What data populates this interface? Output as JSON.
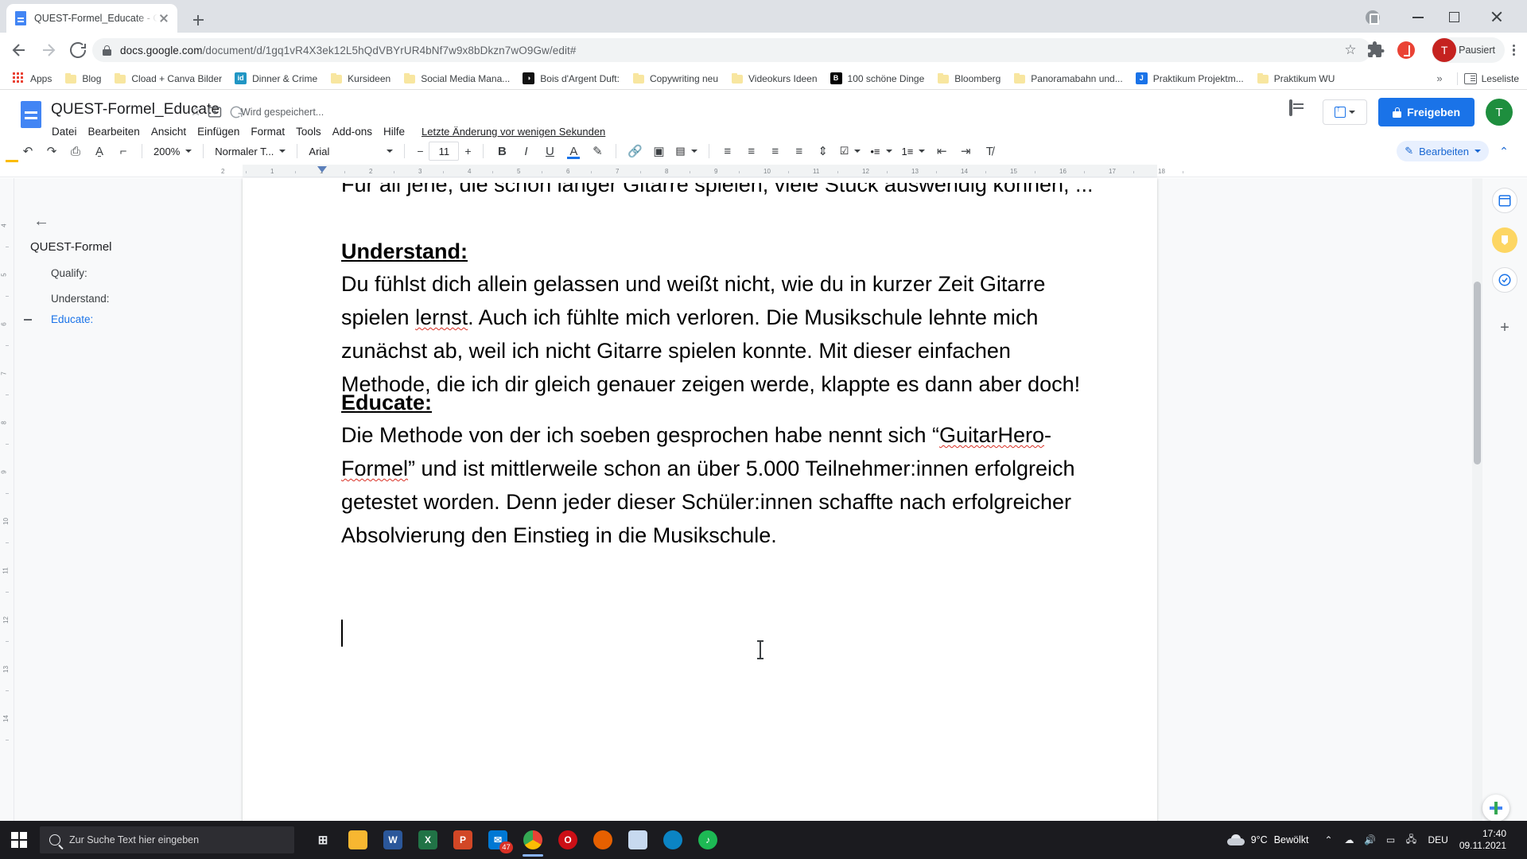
{
  "browser": {
    "tab": {
      "title": "QUEST-Formel_Educate - Google Docs",
      "favicon": "google-docs-icon"
    },
    "new_tab_label": "+",
    "url_host": "docs.google.com",
    "url_path": "/document/d/1gq1vR4X3ek12L5hQdVBYrUR4bNf7w9x8bDkzn7wO9Gw/edit#",
    "profile_label": "Pausiert",
    "profile_initial": "T",
    "bookmarks": [
      {
        "label": "Apps",
        "icon": "apps-grid-icon"
      },
      {
        "label": "Blog",
        "icon": "folder-icon"
      },
      {
        "label": "Cload + Canva Bilder",
        "icon": "folder-icon"
      },
      {
        "label": "Dinner & Crime",
        "icon": "id-favicon",
        "color": "#2196c4",
        "badge": "id"
      },
      {
        "label": "Kursideen",
        "icon": "folder-icon"
      },
      {
        "label": "Social Media Mana...",
        "icon": "folder-icon"
      },
      {
        "label": "Bois d'Argent Duft:",
        "icon": "site-favicon",
        "color": "#111111",
        "badge": "◑"
      },
      {
        "label": "Copywriting neu",
        "icon": "folder-icon"
      },
      {
        "label": "Videokurs Ideen",
        "icon": "folder-icon"
      },
      {
        "label": "100 schöne Dinge",
        "icon": "site-favicon",
        "color": "#000000",
        "badge": "B"
      },
      {
        "label": "Bloomberg",
        "icon": "folder-icon"
      },
      {
        "label": "Panoramabahn und...",
        "icon": "folder-icon"
      },
      {
        "label": "Praktikum Projektm...",
        "icon": "site-favicon",
        "color": "#1a73e8",
        "badge": "J"
      },
      {
        "label": "Praktikum WU",
        "icon": "folder-icon"
      }
    ],
    "overflow_label": "»",
    "reading_list_label": "Leseliste"
  },
  "docs": {
    "title": "QUEST-Formel_Educate",
    "save_state": "Wird gespeichert...",
    "menu": [
      "Datei",
      "Bearbeiten",
      "Ansicht",
      "Einfügen",
      "Format",
      "Tools",
      "Add-ons",
      "Hilfe"
    ],
    "last_edit": "Letzte Änderung vor wenigen Sekunden",
    "share_label": "Freigeben",
    "present_label": "",
    "avatar_initial": "T",
    "toolbar": {
      "zoom": "200%",
      "style": "Normaler T...",
      "font": "Arial",
      "font_size": "11",
      "minus": "−",
      "plus": "+",
      "mode_label": "Bearbeiten"
    },
    "outline": {
      "heading": "QUEST-Formel",
      "items": [
        "Qualify:",
        "Understand:",
        "Educate:"
      ],
      "active_index": 2
    },
    "ruler_ticks": [
      "2",
      "1",
      "1",
      "2",
      "3",
      "4",
      "5",
      "6",
      "7",
      "8",
      "9",
      "10",
      "11",
      "12",
      "13",
      "14",
      "15",
      "16",
      "17",
      "18"
    ],
    "vruler_ticks": [
      "4",
      "5",
      "6",
      "7",
      "8",
      "9",
      "10",
      "11",
      "12",
      "13",
      "14"
    ],
    "content": {
      "truncated_top": "Für all jene, die schon länger Gitarre spielen, viele Stück auswendig können, ...",
      "blocks": [
        {
          "type": "heading",
          "text": "Understand:"
        },
        {
          "type": "paragraph",
          "runs": [
            {
              "t": "Du fühlst dich allein gelassen und weißt nicht, wie du in kurzer Zeit Gitarre spielen "
            },
            {
              "t": "lernst",
              "spell": true
            },
            {
              "t": ". Auch ich fühlte mich verloren. Die Musikschule lehnte mich zunächst ab, weil ich nicht Gitarre spielen konnte. Mit dieser einfachen Methode, die ich dir gleich genauer zeigen werde, klappte es dann aber doch!"
            }
          ]
        },
        {
          "type": "heading",
          "text": "Educate:"
        },
        {
          "type": "paragraph",
          "runs": [
            {
              "t": "Die Methode von der ich soeben gesprochen habe nennt sich “"
            },
            {
              "t": "GuitarHero",
              "spell": true
            },
            {
              "t": "-"
            },
            {
              "t": "Formel",
              "spell": true
            },
            {
              "t": "” und ist mittlerweile schon an über 5.000 Teilnehmer:innen erfolgreich getestet worden. Denn jeder dieser Schüler:innen schaffte nach erfolgreicher Absolvierung den Einstieg in die Musikschule."
            }
          ]
        }
      ]
    }
  },
  "taskbar": {
    "search_placeholder": "Zur Suche Text hier eingeben",
    "apps": [
      {
        "name": "task-view",
        "label": "⊞",
        "color": "transparent"
      },
      {
        "name": "file-explorer",
        "label": "",
        "color": "#f7b731"
      },
      {
        "name": "word",
        "label": "W",
        "color": "#2b579a"
      },
      {
        "name": "excel",
        "label": "X",
        "color": "#217346"
      },
      {
        "name": "powerpoint",
        "label": "P",
        "color": "#d24726"
      },
      {
        "name": "mail",
        "label": "✉",
        "color": "#0078d4",
        "badge": "47"
      },
      {
        "name": "chrome",
        "label": "",
        "color": "#4285f4",
        "active": true
      },
      {
        "name": "opera",
        "label": "O",
        "color": "#cc0f16"
      },
      {
        "name": "firefox",
        "label": "",
        "color": "#e66000"
      },
      {
        "name": "paint",
        "label": "",
        "color": "#c7d9ef"
      },
      {
        "name": "edge",
        "label": "",
        "color": "#0b84c4"
      },
      {
        "name": "spotify",
        "label": "♪",
        "color": "#1db954"
      }
    ],
    "weather_temp": "9°C",
    "weather_text": "Bewölkt",
    "language": "DEU",
    "time": "17:40",
    "date": "09.11.2021"
  }
}
